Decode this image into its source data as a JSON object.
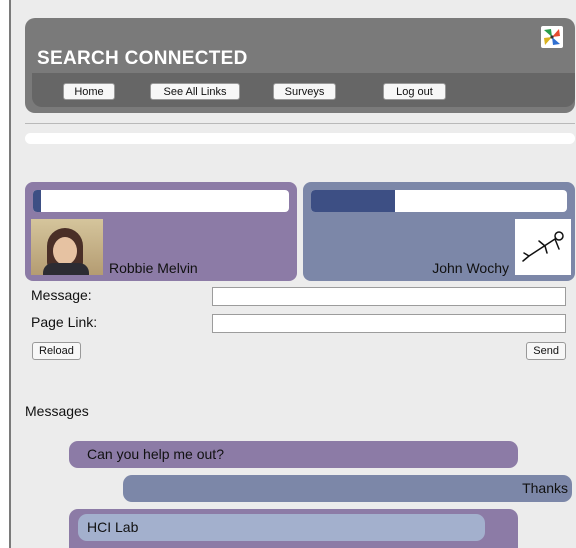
{
  "app": {
    "title": "SEARCH CONNECTED",
    "logo_icon": "pinwheel-icon"
  },
  "nav": {
    "home": "Home",
    "see_all_links": "See All Links",
    "surveys": "Surveys",
    "log_out": "Log out"
  },
  "participants": [
    {
      "name": "Robbie Melvin",
      "progress": 0.03,
      "color": "#8c7ba6"
    },
    {
      "name": "John Wochy",
      "progress": 0.33,
      "color": "#7c87a8"
    }
  ],
  "form": {
    "message_label": "Message:",
    "page_link_label": "Page Link:",
    "message_value": "",
    "page_link_value": "",
    "reload": "Reload",
    "send": "Send"
  },
  "messages_heading": "Messages",
  "messages": [
    {
      "text": "Can you help me out?",
      "from": "Robbie Melvin"
    },
    {
      "text": "Thanks",
      "from": "John Wochy"
    },
    {
      "text": "HCI Lab",
      "from": "Robbie Melvin"
    }
  ],
  "colors": {
    "header": "#7a7a7a",
    "accent_purple": "#8c7ba6",
    "accent_blue": "#7c87a8",
    "progress_fill": "#3d4f84"
  }
}
